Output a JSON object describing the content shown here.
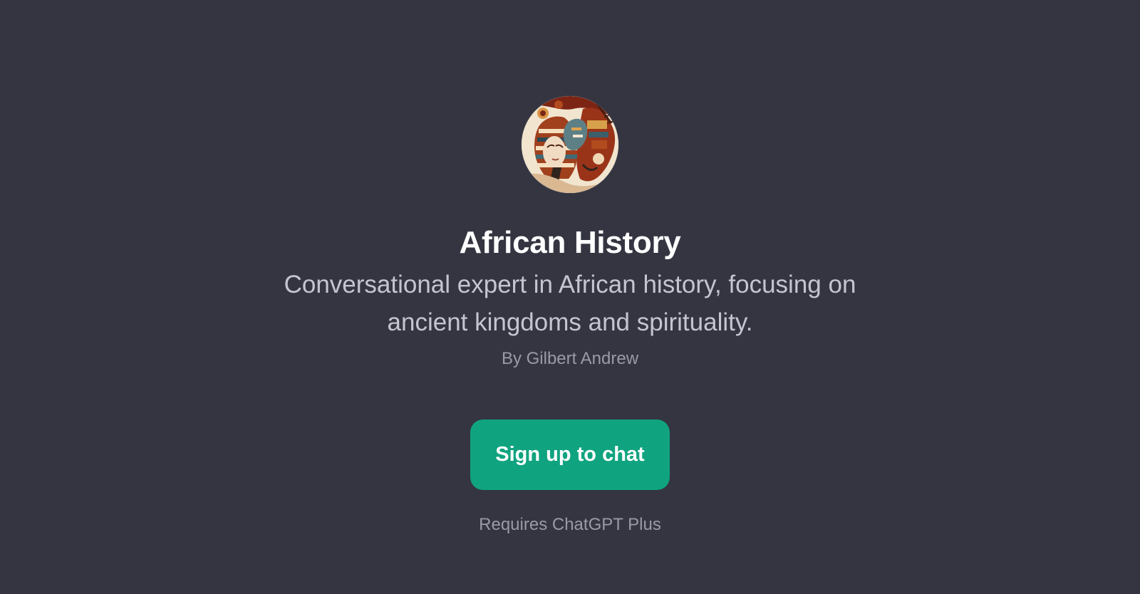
{
  "gpt": {
    "title": "African History",
    "description": "Conversational expert in African history, focusing on ancient kingdoms and spirituality.",
    "author": "By Gilbert Andrew",
    "avatar_icon": "pharaoh-african-art-avatar"
  },
  "actions": {
    "signup_label": "Sign up to chat",
    "requirement_text": "Requires ChatGPT Plus"
  },
  "colors": {
    "background": "#343541",
    "accent": "#10a37f",
    "title": "#ffffff",
    "description": "#c5c5d2",
    "muted": "#9a9aa5"
  }
}
